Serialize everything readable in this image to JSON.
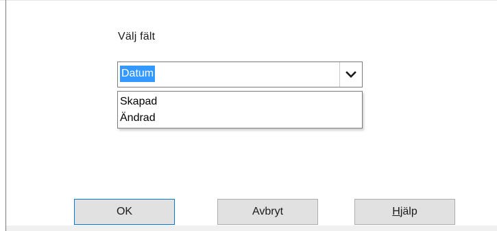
{
  "dialog": {
    "field_label": "Välj fält",
    "combo": {
      "selected_value": "Datum",
      "options": [
        "Skapad",
        "Ändrad"
      ]
    },
    "buttons": {
      "ok_label": "OK",
      "cancel_label": "Avbryt",
      "help_label_mnemonic": "H",
      "help_label_rest": "jälp"
    }
  },
  "icons": {
    "dropdown_arrow": "chevron-down-icon"
  },
  "colors": {
    "selection_highlight": "#3399ff",
    "default_button_border": "#0078d7",
    "button_face": "#e1e1e1"
  }
}
